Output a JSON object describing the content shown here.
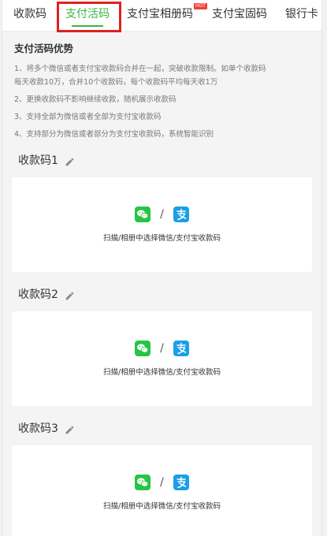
{
  "tabs": [
    {
      "label": "收款码",
      "active": false
    },
    {
      "label": "支付活码",
      "active": true
    },
    {
      "label": "支付宝相册码",
      "active": false,
      "badge": "HOT"
    },
    {
      "label": "支付宝固码",
      "active": false
    },
    {
      "label": "银行卡",
      "active": false
    }
  ],
  "intro": {
    "title": "支付活码优势",
    "points": [
      "1、将多个微信或者支付宝收款码合并在一起，突破收款限制。如单个收款码",
      "每天收款10万，合并10个收款码，每个收款码平均每天收1万",
      "2、更换收款码不影响继续收款，随机展示收款码",
      "3、支持全部为微信或者全部为支付宝收款码",
      "4、支持部分为微信或者部分为支付宝收款码，系统智能识别"
    ]
  },
  "sections": [
    {
      "title": "收款码1",
      "prompt": "扫描/相册中选择微信/支付宝收款码"
    },
    {
      "title": "收款码2",
      "prompt": "扫描/相册中选择微信/支付宝收款码"
    },
    {
      "title": "收款码3",
      "prompt": "扫描/相册中选择微信/支付宝收款码"
    }
  ],
  "icons": {
    "wechat": "wechat-icon",
    "alipay": "alipay-icon",
    "edit": "pencil-icon"
  },
  "separator": "/",
  "colors": {
    "accent": "#3fb543",
    "highlight": "#e0211e",
    "wechat": "#28c445",
    "alipay": "#1a9fe8"
  }
}
